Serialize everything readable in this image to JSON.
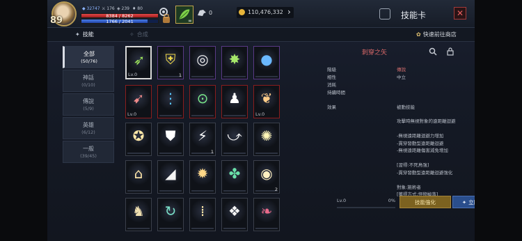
{
  "player": {
    "level": "89",
    "stats": [
      "32747",
      "176",
      "239",
      "80"
    ],
    "hp_text": "8384 / 8262",
    "mp_text": "1766 / 2041",
    "hp_fraction": 1.0,
    "mp_fraction": 0.865
  },
  "topbar": {
    "pet_count": "∞",
    "mount_count": "0",
    "gold": "110,476,332",
    "title": "技能卡",
    "close_label": "✕"
  },
  "tabs": {
    "skills": "技能",
    "combine": "合成",
    "shop": "快速前往商店"
  },
  "categories": [
    {
      "name": "全部",
      "count": "(50/76)"
    },
    {
      "name": "神話",
      "count": "(0/10)"
    },
    {
      "name": "傳說",
      "count": "(5/9)"
    },
    {
      "name": "英雄",
      "count": "(6/12)"
    },
    {
      "name": "一般",
      "count": "(39/45)"
    }
  ],
  "grid": {
    "slots": [
      {
        "icon": "arrow-pierce-icon",
        "label": "Lv.0",
        "count": ""
      },
      {
        "icon": "shield-potion-icon",
        "label": "",
        "count": "1"
      },
      {
        "icon": "vortex-icon",
        "label": "",
        "count": ""
      },
      {
        "icon": "leaf-burst-icon",
        "label": "",
        "count": ""
      },
      {
        "icon": "orb-icon",
        "label": "",
        "count": ""
      },
      {
        "icon": "crossbow-icon",
        "label": "Lv.0",
        "count": ""
      },
      {
        "icon": "waterfall-icon",
        "label": "",
        "count": ""
      },
      {
        "icon": "target-icon",
        "label": "",
        "count": ""
      },
      {
        "icon": "figure-icon",
        "label": "",
        "count": ""
      },
      {
        "icon": "wing-bow-icon",
        "label": "Lv.0",
        "count": ""
      },
      {
        "icon": "sparkle-circle-icon",
        "label": "",
        "count": ""
      },
      {
        "icon": "shield-icon",
        "label": "",
        "count": ""
      },
      {
        "icon": "lightning-icon",
        "label": "",
        "count": "1"
      },
      {
        "icon": "swoop-icon",
        "label": "",
        "count": ""
      },
      {
        "icon": "starburst-icon",
        "label": "",
        "count": ""
      },
      {
        "icon": "tent-icon",
        "label": "",
        "count": ""
      },
      {
        "icon": "triangle-slash-icon",
        "label": "",
        "count": ""
      },
      {
        "icon": "gear-burst-icon",
        "label": "",
        "count": ""
      },
      {
        "icon": "fish-leaf-icon",
        "label": "",
        "count": ""
      },
      {
        "icon": "lamp-icon",
        "label": "",
        "count": "2"
      },
      {
        "icon": "hooded-figure-icon",
        "label": "",
        "count": ""
      },
      {
        "icon": "arrow-loop-icon",
        "label": "",
        "count": ""
      },
      {
        "icon": "pillars-icon",
        "label": "",
        "count": ""
      },
      {
        "icon": "claw-icon",
        "label": "",
        "count": ""
      },
      {
        "icon": "red-wing-icon",
        "label": "",
        "count": ""
      }
    ]
  },
  "detail": {
    "name": "刺穿之矢",
    "fields": [
      {
        "label": "階級",
        "value": "傳說"
      },
      {
        "label": "相性",
        "value": "中立"
      },
      {
        "label": "消耗",
        "value": ""
      },
      {
        "label": "持續時間",
        "value": ""
      }
    ],
    "effect_label": "效果",
    "effect_type": "被動技能",
    "effect_lines": [
      "攻擊時無視對象的遠距離迴避",
      "",
      "-無視遠距離迴避力增加",
      "-貫穿發動型遠距離迴避",
      "-無視遠距離傷害減免增加",
      "",
      "[習得:不死鳥強]",
      "-貫穿發動型遠距離迴避強化",
      "",
      "對象:施術者",
      "[獲得方式:怪物掉落]"
    ],
    "level": "Lv.0",
    "progress": "0%",
    "enhance_button": "技能強化",
    "goto_button": "立即前往技能"
  },
  "colors": {
    "legend_red": "#d86868",
    "hero_purple": "#5a3a86",
    "selected": "#d9d9d9"
  }
}
